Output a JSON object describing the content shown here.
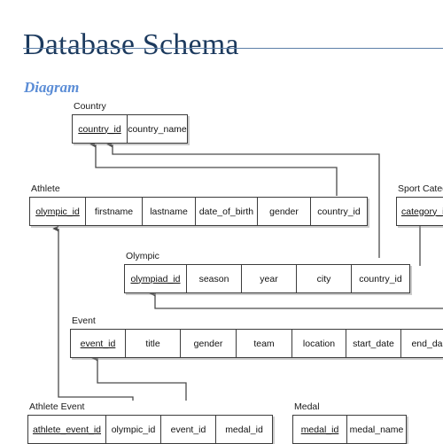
{
  "document": {
    "title": "Database Schema",
    "section_heading": "Diagram"
  },
  "theme": {
    "title_color": "#1c3a5e",
    "rule_color": "#5c7fa8",
    "heading_color": "#5b8dd6",
    "table_border_color": "#3c3c3c",
    "connector_color": "#4a4a4a",
    "table_fill": "#ffffff"
  },
  "diagram": {
    "type": "entity-relationship-diagram",
    "note": "Olympics database schema; right and bottom edges are clipped by the viewport",
    "entities": [
      {
        "name": "Country",
        "label": "Country",
        "columns": [
          {
            "name": "country_id",
            "primary_key": true
          },
          {
            "name": "country_name",
            "primary_key": false
          }
        ]
      },
      {
        "name": "Athlete",
        "label": "Athlete",
        "columns": [
          {
            "name": "olympic_id",
            "primary_key": true
          },
          {
            "name": "firstname",
            "primary_key": false
          },
          {
            "name": "lastname",
            "primary_key": false
          },
          {
            "name": "date_of_birth",
            "primary_key": false
          },
          {
            "name": "gender",
            "primary_key": false
          },
          {
            "name": "country_id",
            "primary_key": false
          }
        ]
      },
      {
        "name": "Sport Category",
        "label": "Sport Categ",
        "columns": [
          {
            "name": "category_id",
            "primary_key": true
          }
        ]
      },
      {
        "name": "Olympic",
        "label": "Olympic",
        "columns": [
          {
            "name": "olympiad_id",
            "primary_key": true
          },
          {
            "name": "season",
            "primary_key": false
          },
          {
            "name": "year",
            "primary_key": false
          },
          {
            "name": "city",
            "primary_key": false
          },
          {
            "name": "country_id",
            "primary_key": false
          }
        ]
      },
      {
        "name": "Event",
        "label": "Event",
        "columns": [
          {
            "name": "event_id",
            "primary_key": true
          },
          {
            "name": "title",
            "primary_key": false
          },
          {
            "name": "gender",
            "primary_key": false
          },
          {
            "name": "team",
            "primary_key": false
          },
          {
            "name": "location",
            "primary_key": false
          },
          {
            "name": "start_date",
            "primary_key": false
          },
          {
            "name": "end_da",
            "primary_key": false
          }
        ]
      },
      {
        "name": "Athlete Event",
        "label": "Athlete Event",
        "columns": [
          {
            "name": "athlete_event_id",
            "primary_key": true
          },
          {
            "name": "olympic_id",
            "primary_key": false
          },
          {
            "name": "event_id",
            "primary_key": false
          },
          {
            "name": "medal_id",
            "primary_key": false
          }
        ]
      },
      {
        "name": "Medal",
        "label": "Medal",
        "columns": [
          {
            "name": "medal_id",
            "primary_key": true
          },
          {
            "name": "medal_name",
            "primary_key": false
          }
        ]
      }
    ],
    "relationships": [
      {
        "from": "Athlete.country_id",
        "to": "Country.country_id"
      },
      {
        "from": "Olympic.country_id",
        "to": "Country.country_id"
      },
      {
        "from": "Athlete Event.olympic_id",
        "to": "Athlete.olympic_id"
      },
      {
        "from": "Athlete Event.event_id",
        "to": "Event.event_id"
      },
      {
        "from": "Event.end_date_region",
        "to": "Olympic.olympiad_id"
      },
      {
        "from": "Athlete Event.medal_id",
        "to": "Medal.medal_id"
      },
      {
        "from": "Sport Category.category_id",
        "to": "below-viewport"
      }
    ]
  }
}
